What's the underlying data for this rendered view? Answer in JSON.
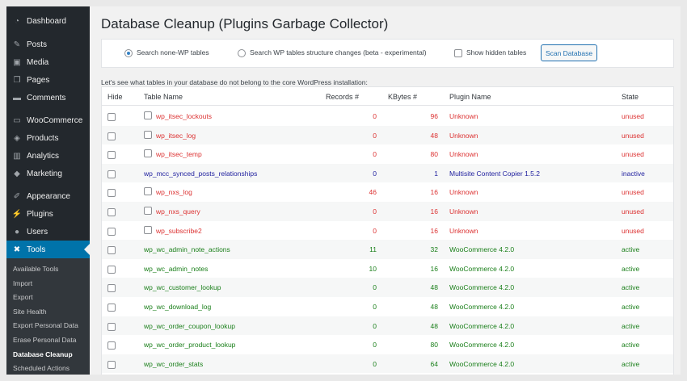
{
  "sidebar": {
    "items": [
      {
        "label": "Dashboard",
        "icon": "dashboard-icon",
        "glyph": "◔"
      },
      {
        "label": "Posts",
        "icon": "pushpin-icon",
        "glyph": "✎"
      },
      {
        "label": "Media",
        "icon": "media-icon",
        "glyph": "▣"
      },
      {
        "label": "Pages",
        "icon": "pages-icon",
        "glyph": "❐"
      },
      {
        "label": "Comments",
        "icon": "comments-icon",
        "glyph": "▬"
      },
      {
        "label": "WooCommerce",
        "icon": "woocommerce-icon",
        "glyph": "▭"
      },
      {
        "label": "Products",
        "icon": "products-icon",
        "glyph": "◈"
      },
      {
        "label": "Analytics",
        "icon": "analytics-icon",
        "glyph": "▥"
      },
      {
        "label": "Marketing",
        "icon": "marketing-icon",
        "glyph": "◆"
      },
      {
        "label": "Appearance",
        "icon": "appearance-icon",
        "glyph": "✐"
      },
      {
        "label": "Plugins",
        "icon": "plugins-icon",
        "glyph": "⚡"
      },
      {
        "label": "Users",
        "icon": "users-icon",
        "glyph": "●"
      },
      {
        "label": "Tools",
        "icon": "wrench-icon",
        "glyph": "✖"
      }
    ],
    "submenu": [
      "Available Tools",
      "Import",
      "Export",
      "Site Health",
      "Export Personal Data",
      "Erase Personal Data",
      "Database Cleanup",
      "Scheduled Actions"
    ]
  },
  "page": {
    "title": "Database Cleanup (Plugins Garbage Collector)",
    "options": {
      "radio1": "Search none-WP tables",
      "radio2": "Search WP tables structure changes (beta - experimental)",
      "checkbox": "Show hidden tables",
      "scan_button": "Scan Database"
    },
    "intro": "Let's see what tables in your database do not belong to the core WordPress installation:"
  },
  "table": {
    "headers": [
      "Hide",
      "Table Name",
      "Records #",
      "KBytes #",
      "Plugin Name",
      "State"
    ],
    "rows": [
      {
        "name": "wp_itsec_lockouts",
        "records": "0",
        "kbytes": "96",
        "plugin": "Unknown",
        "state": "unused",
        "name_checkbox": true
      },
      {
        "name": "wp_itsec_log",
        "records": "0",
        "kbytes": "48",
        "plugin": "Unknown",
        "state": "unused",
        "name_checkbox": true
      },
      {
        "name": "wp_itsec_temp",
        "records": "0",
        "kbytes": "80",
        "plugin": "Unknown",
        "state": "unused",
        "name_checkbox": true
      },
      {
        "name": "wp_mcc_synced_posts_relationships",
        "records": "0",
        "kbytes": "1",
        "plugin": "Multisite Content Copier 1.5.2",
        "state": "inactive",
        "name_checkbox": false
      },
      {
        "name": "wp_nxs_log",
        "records": "46",
        "kbytes": "16",
        "plugin": "Unknown",
        "state": "unused",
        "name_checkbox": true
      },
      {
        "name": "wp_nxs_query",
        "records": "0",
        "kbytes": "16",
        "plugin": "Unknown",
        "state": "unused",
        "name_checkbox": true
      },
      {
        "name": "wp_subscribe2",
        "records": "0",
        "kbytes": "16",
        "plugin": "Unknown",
        "state": "unused",
        "name_checkbox": true
      },
      {
        "name": "wp_wc_admin_note_actions",
        "records": "11",
        "kbytes": "32",
        "plugin": "WooCommerce 4.2.0",
        "state": "active",
        "name_checkbox": false
      },
      {
        "name": "wp_wc_admin_notes",
        "records": "10",
        "kbytes": "16",
        "plugin": "WooCommerce 4.2.0",
        "state": "active",
        "name_checkbox": false
      },
      {
        "name": "wp_wc_customer_lookup",
        "records": "0",
        "kbytes": "48",
        "plugin": "WooCommerce 4.2.0",
        "state": "active",
        "name_checkbox": false
      },
      {
        "name": "wp_wc_download_log",
        "records": "0",
        "kbytes": "48",
        "plugin": "WooCommerce 4.2.0",
        "state": "active",
        "name_checkbox": false
      },
      {
        "name": "wp_wc_order_coupon_lookup",
        "records": "0",
        "kbytes": "48",
        "plugin": "WooCommerce 4.2.0",
        "state": "active",
        "name_checkbox": false
      },
      {
        "name": "wp_wc_order_product_lookup",
        "records": "0",
        "kbytes": "80",
        "plugin": "WooCommerce 4.2.0",
        "state": "active",
        "name_checkbox": false
      },
      {
        "name": "wp_wc_order_stats",
        "records": "0",
        "kbytes": "64",
        "plugin": "WooCommerce 4.2.0",
        "state": "active",
        "name_checkbox": false
      }
    ]
  },
  "colors": {
    "unused": "#dc3232",
    "inactive": "#1e1e9e",
    "active": "#1a7f1a",
    "accent": "#0073aa"
  }
}
